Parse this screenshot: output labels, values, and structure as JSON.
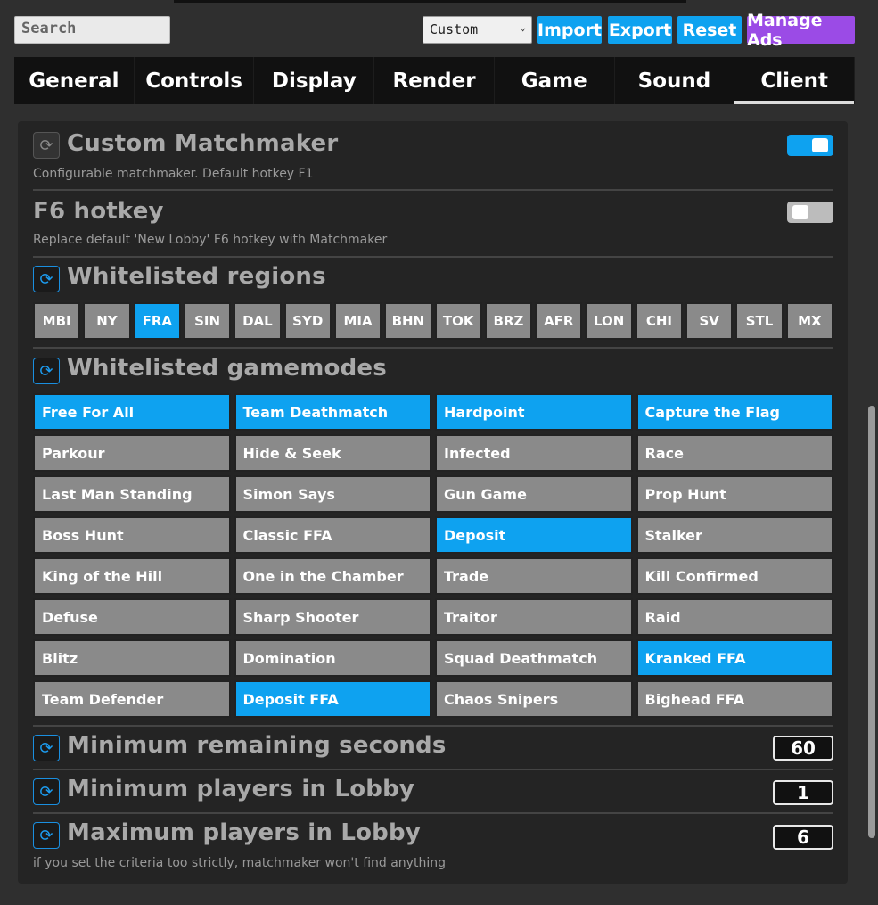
{
  "topbar": {
    "search_placeholder": "Search",
    "preset": "Custom",
    "buttons": {
      "import": "Import",
      "export": "Export",
      "reset": "Reset",
      "manage_ads": "Manage Ads"
    }
  },
  "tabs": [
    "General",
    "Controls",
    "Display",
    "Render",
    "Game",
    "Sound",
    "Client"
  ],
  "active_tab": "Client",
  "custom_matchmaker": {
    "title": "Custom Matchmaker",
    "desc": "Configurable matchmaker. Default hotkey F1",
    "enabled": true
  },
  "f6_hotkey": {
    "title": "F6 hotkey",
    "desc": "Replace default 'New Lobby' F6 hotkey with Matchmaker",
    "enabled": false
  },
  "regions": {
    "title": "Whitelisted regions",
    "items": [
      {
        "label": "MBI",
        "on": false
      },
      {
        "label": "NY",
        "on": false
      },
      {
        "label": "FRA",
        "on": true
      },
      {
        "label": "SIN",
        "on": false
      },
      {
        "label": "DAL",
        "on": false
      },
      {
        "label": "SYD",
        "on": false
      },
      {
        "label": "MIA",
        "on": false
      },
      {
        "label": "BHN",
        "on": false
      },
      {
        "label": "TOK",
        "on": false
      },
      {
        "label": "BRZ",
        "on": false
      },
      {
        "label": "AFR",
        "on": false
      },
      {
        "label": "LON",
        "on": false
      },
      {
        "label": "CHI",
        "on": false
      },
      {
        "label": "SV",
        "on": false
      },
      {
        "label": "STL",
        "on": false
      },
      {
        "label": "MX",
        "on": false
      }
    ]
  },
  "gamemodes": {
    "title": "Whitelisted gamemodes",
    "items": [
      {
        "label": "Free For All",
        "on": true
      },
      {
        "label": "Team Deathmatch",
        "on": true
      },
      {
        "label": "Hardpoint",
        "on": true
      },
      {
        "label": "Capture the Flag",
        "on": true
      },
      {
        "label": "Parkour",
        "on": false
      },
      {
        "label": "Hide & Seek",
        "on": false
      },
      {
        "label": "Infected",
        "on": false
      },
      {
        "label": "Race",
        "on": false
      },
      {
        "label": "Last Man Standing",
        "on": false
      },
      {
        "label": "Simon Says",
        "on": false
      },
      {
        "label": "Gun Game",
        "on": false
      },
      {
        "label": "Prop Hunt",
        "on": false
      },
      {
        "label": "Boss Hunt",
        "on": false
      },
      {
        "label": "Classic FFA",
        "on": false
      },
      {
        "label": "Deposit",
        "on": true
      },
      {
        "label": "Stalker",
        "on": false
      },
      {
        "label": "King of the Hill",
        "on": false
      },
      {
        "label": "One in the Chamber",
        "on": false
      },
      {
        "label": "Trade",
        "on": false
      },
      {
        "label": "Kill Confirmed",
        "on": false
      },
      {
        "label": "Defuse",
        "on": false
      },
      {
        "label": "Sharp Shooter",
        "on": false
      },
      {
        "label": "Traitor",
        "on": false
      },
      {
        "label": "Raid",
        "on": false
      },
      {
        "label": "Blitz",
        "on": false
      },
      {
        "label": "Domination",
        "on": false
      },
      {
        "label": "Squad Deathmatch",
        "on": false
      },
      {
        "label": "Kranked FFA",
        "on": true
      },
      {
        "label": "Team Defender",
        "on": false
      },
      {
        "label": "Deposit FFA",
        "on": true
      },
      {
        "label": "Chaos Snipers",
        "on": false
      },
      {
        "label": "Bighead FFA",
        "on": false
      }
    ]
  },
  "min_seconds": {
    "title": "Minimum remaining seconds",
    "value": "60"
  },
  "min_players": {
    "title": "Minimum players in Lobby",
    "value": "1"
  },
  "max_players": {
    "title": "Maximum players in Lobby",
    "value": "6"
  },
  "footer_note": "if you set the criteria too strictly, matchmaker won't find anything",
  "colors": {
    "accent": "#0ea2f0",
    "manage_ads": "#9b4be6",
    "inactive": "#8a8a8a"
  }
}
